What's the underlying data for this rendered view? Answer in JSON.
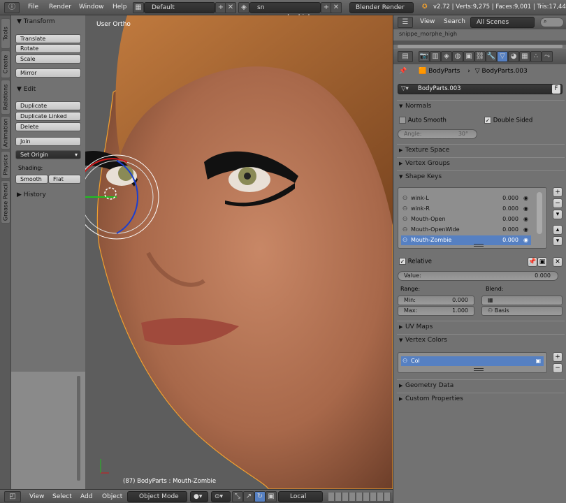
{
  "topbar": {
    "menus": [
      "File",
      "Render",
      "Window",
      "Help"
    ],
    "layout": "Default",
    "scene": "sn per_morphe_high",
    "engine": "Blender Render",
    "stats": "v2.72 | Verts:9,275 | Faces:9,001 | Tris:17,449"
  },
  "vtabs": [
    "Tools",
    "Create",
    "Relations",
    "Animation",
    "Physics",
    "Grease Pencil"
  ],
  "toolshelf": {
    "transform_title": "Transform",
    "transform_buttons": [
      "Translate",
      "Rotate",
      "Scale",
      "Mirror"
    ],
    "edit_title": "Edit",
    "edit_buttons": [
      "Duplicate",
      "Duplicate Linked",
      "Delete",
      "Join"
    ],
    "set_origin": "Set Origin",
    "shading_label": "Shading:",
    "smooth": "Smooth",
    "flat": "Flat",
    "history_title": "History"
  },
  "viewport": {
    "view_label": "User Ortho",
    "object_label": "(87) BodyParts : Mouth-Zombie"
  },
  "bottombar": {
    "menus": [
      "View",
      "Select",
      "Add",
      "Object"
    ],
    "mode": "Object Mode",
    "orientation": "Local"
  },
  "props": {
    "header": {
      "view": "View",
      "search": "Search",
      "scenes": "All Scenes",
      "outliner_item": "snippe_morphe_high"
    },
    "breadcrumb": {
      "object": "BodyParts",
      "data": "BodyParts.003"
    },
    "mesh_name": "BodyParts.003",
    "mesh_users": "F",
    "normals": {
      "title": "Normals",
      "auto_smooth": "Auto Smooth",
      "double_sided": "Double Sided",
      "angle_label": "Angle:",
      "angle_value": "30°"
    },
    "texture_space": "Texture Space",
    "vertex_groups": "Vertex Groups",
    "shape_keys": {
      "title": "Shape Keys",
      "items": [
        {
          "name": "wink-L",
          "value": "0.000"
        },
        {
          "name": "wink-R",
          "value": "0.000"
        },
        {
          "name": "Mouth-Open",
          "value": "0.000"
        },
        {
          "name": "Mouth-OpenWide",
          "value": "0.000"
        },
        {
          "name": "Mouth-Zombie",
          "value": "0.000"
        }
      ],
      "relative": "Relative",
      "value_label": "Value:",
      "value": "0.000",
      "range_label": "Range:",
      "min_label": "Min:",
      "min_value": "0.000",
      "max_label": "Max:",
      "max_value": "1.000",
      "blend_label": "Blend:",
      "blend_basis": "Basis"
    },
    "uv_maps": "UV Maps",
    "vertex_colors": {
      "title": "Vertex Colors",
      "item": "Col"
    },
    "geometry_data": "Geometry Data",
    "custom_properties": "Custom Properties"
  }
}
